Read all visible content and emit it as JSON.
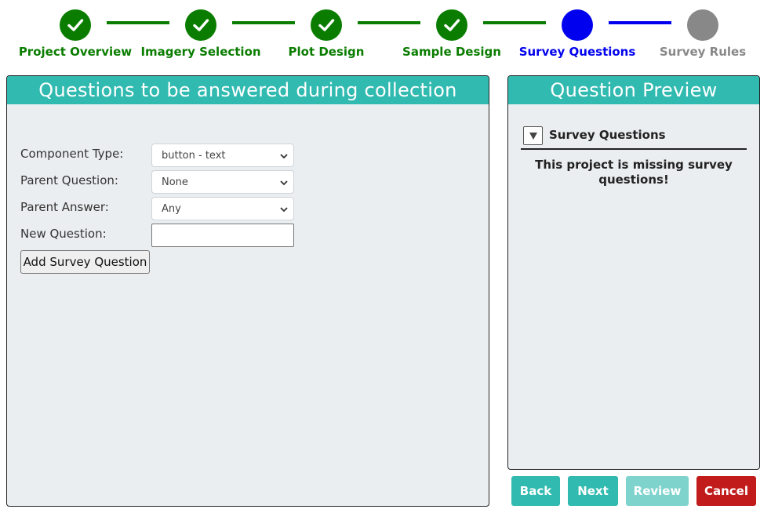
{
  "stepper": {
    "steps": [
      {
        "label": "Project Overview",
        "status": "complete",
        "color": "#0a7d00"
      },
      {
        "label": "Imagery Selection",
        "status": "complete",
        "color": "#0a7d00"
      },
      {
        "label": "Plot Design",
        "status": "complete",
        "color": "#0a7d00"
      },
      {
        "label": "Sample Design",
        "status": "complete",
        "color": "#0a7d00"
      },
      {
        "label": "Survey Questions",
        "status": "current",
        "color": "#0000ee"
      },
      {
        "label": "Survey Rules",
        "status": "upcoming",
        "color": "#888888"
      }
    ],
    "icons": {
      "complete": "check-icon"
    }
  },
  "questions_panel": {
    "title": "Questions to be answered during collection",
    "component_type": {
      "label": "Component Type:",
      "value": "button - text"
    },
    "parent_question": {
      "label": "Parent Question:",
      "value": "None"
    },
    "parent_answer": {
      "label": "Parent Answer:",
      "value": "Any"
    },
    "new_question": {
      "label": "New Question:",
      "value": ""
    },
    "add_button": "Add Survey Question"
  },
  "preview_panel": {
    "title": "Question Preview",
    "section_title": "Survey Questions",
    "collapse_icon": "triangle-down-icon",
    "missing_line1": "This project is missing survey",
    "missing_line2": "questions!"
  },
  "actions": {
    "back": "Back",
    "next": "Next",
    "review": "Review",
    "cancel": "Cancel"
  },
  "colors": {
    "teal": "#31bab0",
    "teal_disabled": "#7fd3cd",
    "cancel_red": "#c11b1b",
    "panel_bg": "#ebeef0"
  }
}
